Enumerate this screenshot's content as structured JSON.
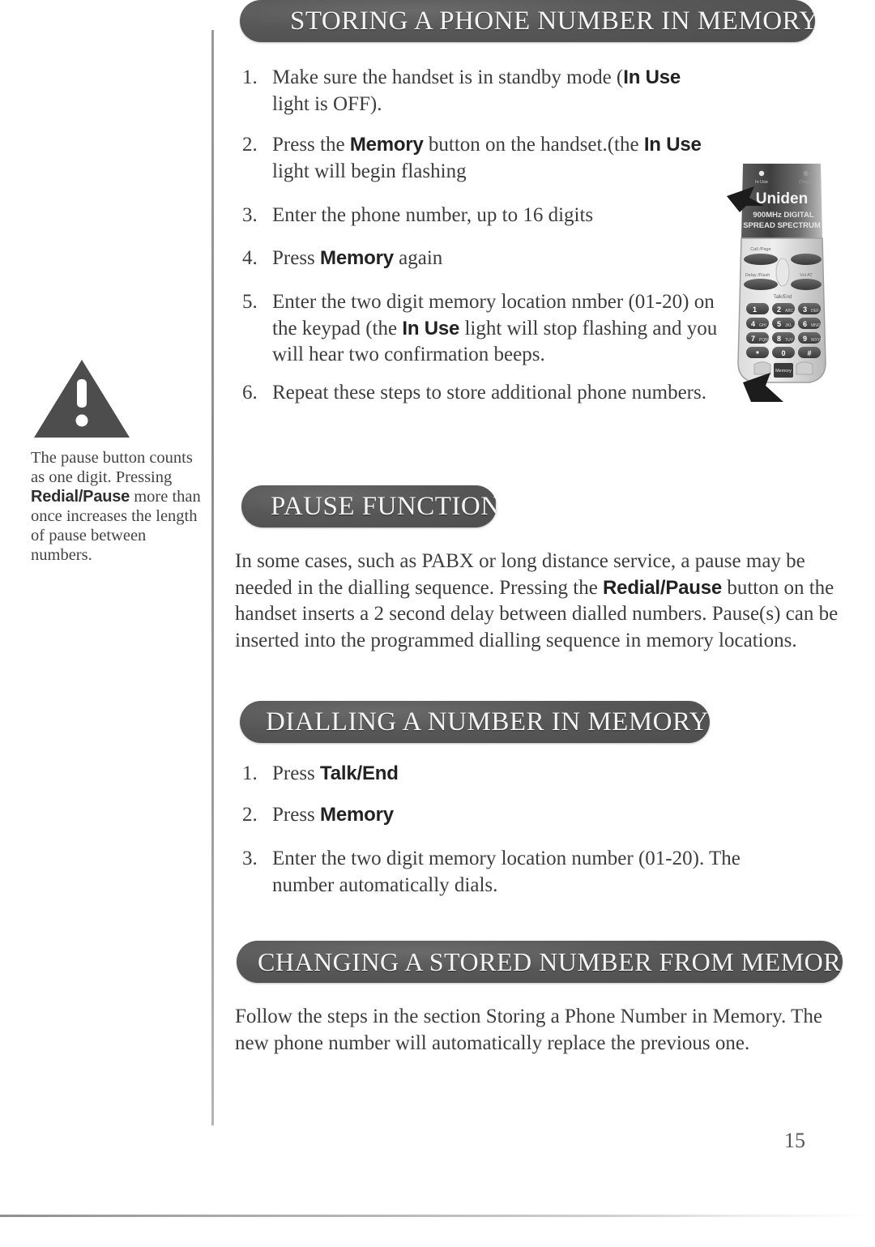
{
  "document": {
    "page_number": "15",
    "brand": "Uniden"
  },
  "margin_note": {
    "icon": "warning-triangle-icon",
    "line1": "The pause button counts as",
    "line2": "one digit. Pressing",
    "bold_term": "Redial/Pause",
    "line3_rest": " more",
    "line4": "than once increases the",
    "line5": "length of pause between",
    "line6": "numbers."
  },
  "sections": {
    "storing": {
      "heading": "STORING A PHONE NUMBER IN MEMORY",
      "steps": [
        {
          "num": "1.",
          "parts": [
            {
              "t": "Make sure the handset is in standby mode (",
              "b": false
            },
            {
              "t": "In Use",
              "b": true
            },
            {
              "t": " light is OFF).",
              "b": false
            }
          ]
        },
        {
          "num": "2.",
          "parts": [
            {
              "t": "Press the ",
              "b": false
            },
            {
              "t": "Memory",
              "b": true
            },
            {
              "t": " button on the handset.(the ",
              "b": false
            },
            {
              "t": "In Use",
              "b": true
            },
            {
              "t": " light will begin flashing",
              "b": false
            }
          ]
        },
        {
          "num": "3.",
          "parts": [
            {
              "t": "Enter the phone number, up to 16 digits",
              "b": false
            }
          ]
        },
        {
          "num": "4.",
          "parts": [
            {
              "t": "Press ",
              "b": false
            },
            {
              "t": "Memory",
              "b": true
            },
            {
              "t": " again",
              "b": false
            }
          ]
        },
        {
          "num": "5.",
          "parts": [
            {
              "t": "Enter the two digit memory location nmber (01-20) on the keypad (the ",
              "b": false
            },
            {
              "t": "In Use",
              "b": true
            },
            {
              "t": " light will stop flashing and you will hear two confirmation beeps.",
              "b": false
            }
          ]
        },
        {
          "num": "6.",
          "parts": [
            {
              "t": "Repeat these steps to store additional phone numbers.",
              "b": false
            }
          ]
        }
      ]
    },
    "pause": {
      "heading": "PAUSE FUNCTION",
      "body_parts": [
        {
          "t": "In some cases, such as PABX or long distance service, a pause may be needed in the dialling sequence.  Pressing the ",
          "b": false
        },
        {
          "t": "Redial/Pause",
          "b": true
        },
        {
          "t": " button on the handset inserts a 2 second delay between dialled numbers.  Pause(s) can be inserted into the programmed dialling sequence in memory locations.",
          "b": false
        }
      ]
    },
    "dialling": {
      "heading": "DIALLING A NUMBER IN MEMORY",
      "steps": [
        {
          "num": "1.",
          "parts": [
            {
              "t": "Press ",
              "b": false
            },
            {
              "t": "Talk/End",
              "b": true
            }
          ]
        },
        {
          "num": "2.",
          "parts": [
            {
              "t": "Press ",
              "b": false
            },
            {
              "t": "Memory",
              "b": true
            }
          ]
        },
        {
          "num": "3.",
          "parts": [
            {
              "t": "Enter the two digit memory location number (01-20). The number automatically dials.",
              "b": false
            }
          ]
        }
      ]
    },
    "changing": {
      "heading": "CHANGING A STORED NUMBER FROM MEMORY",
      "body_parts": [
        {
          "t": "Follow the steps in the section Storing a Phone Number in Memory.  The new phone number will automatically replace the previous one.",
          "b": false
        }
      ]
    }
  },
  "phone_figure": {
    "brand": "Uniden",
    "spec_line1": "900MHz DIGITAL",
    "spec_line2": "SPREAD SPECTRUM",
    "indicator_left": "In Use",
    "indicator_right": "Charge",
    "label_callpage": "Call /Page",
    "label_volume": "Vol",
    "label_mem": "AT",
    "label_delay": "Delay /Flash",
    "label_talkend": "Talk/End",
    "keypad": [
      {
        "digit": "1",
        "letters": ""
      },
      {
        "digit": "2",
        "letters": "ABC"
      },
      {
        "digit": "3",
        "letters": "DEF"
      },
      {
        "digit": "4",
        "letters": "GHI"
      },
      {
        "digit": "5",
        "letters": "JKL"
      },
      {
        "digit": "6",
        "letters": "MNO"
      },
      {
        "digit": "7",
        "letters": "PQRS"
      },
      {
        "digit": "8",
        "letters": "TUV"
      },
      {
        "digit": "9",
        "letters": "WXYZ"
      },
      {
        "digit": "*",
        "letters": ""
      },
      {
        "digit": "0",
        "letters": ""
      },
      {
        "digit": "#",
        "letters": ""
      }
    ],
    "memory_button": "Memory",
    "callout_top": "arrow pointing to In Use light",
    "callout_bottom": "arrow pointing to Memory button"
  },
  "colors": {
    "pill_background": "#575757",
    "pill_text": "#f4f4f4",
    "body_text": "#3d3d3d",
    "rule": "#9a9a9a"
  }
}
